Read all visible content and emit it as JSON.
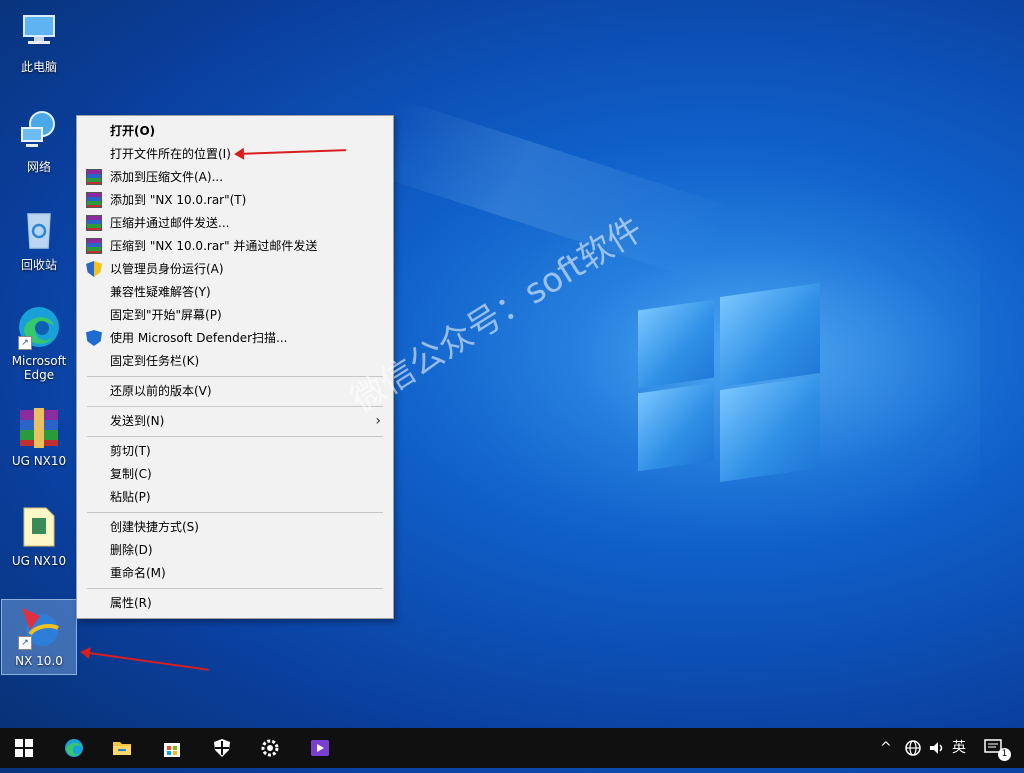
{
  "desktop": {
    "icons": [
      {
        "label": "此电脑",
        "icon": "computer-icon"
      },
      {
        "label": "网络",
        "icon": "network-icon"
      },
      {
        "label": "回收站",
        "icon": "recycle-bin-icon"
      },
      {
        "label": "Microsoft Edge",
        "icon": "edge-icon"
      },
      {
        "label": "UG NX10",
        "icon": "winrar-archive-icon"
      },
      {
        "label": "UG NX10",
        "icon": "folder-icon"
      },
      {
        "label": "NX 10.0",
        "icon": "nx-app-icon"
      }
    ],
    "watermark": "微信公众号：soft软件"
  },
  "context_menu": {
    "items": [
      {
        "label": "打开(O)",
        "bold": true
      },
      {
        "label": "打开文件所在的位置(I)"
      },
      {
        "label": "添加到压缩文件(A)...",
        "icon": "winrar-icon"
      },
      {
        "label": "添加到 \"NX 10.0.rar\"(T)",
        "icon": "winrar-icon"
      },
      {
        "label": "压缩并通过邮件发送...",
        "icon": "winrar-icon"
      },
      {
        "label": "压缩到 \"NX 10.0.rar\" 并通过邮件发送",
        "icon": "winrar-icon"
      },
      {
        "label": "以管理员身份运行(A)",
        "icon": "uac-shield-icon"
      },
      {
        "label": "兼容性疑难解答(Y)"
      },
      {
        "label": "固定到\"开始\"屏幕(P)"
      },
      {
        "label": "使用 Microsoft Defender扫描...",
        "icon": "defender-shield-icon"
      },
      {
        "label": "固定到任务栏(K)"
      },
      {
        "label": "还原以前的版本(V)"
      },
      {
        "label": "发送到(N)",
        "submenu": true
      },
      {
        "label": "剪切(T)"
      },
      {
        "label": "复制(C)"
      },
      {
        "label": "粘贴(P)"
      },
      {
        "label": "创建快捷方式(S)"
      },
      {
        "label": "删除(D)"
      },
      {
        "label": "重命名(M)"
      },
      {
        "label": "属性(R)"
      }
    ]
  },
  "taskbar": {
    "apps": [
      "start-icon",
      "edge-icon",
      "file-explorer-icon",
      "store-icon",
      "security-icon",
      "settings-icon",
      "media-player-icon"
    ],
    "tray": {
      "chevron": "^",
      "ime": "英",
      "notification_count": "1"
    }
  },
  "colors": {
    "annotation_red": "#d81e1e",
    "menu_bg": "#f2f2f2",
    "taskbar_bg": "#101010"
  }
}
